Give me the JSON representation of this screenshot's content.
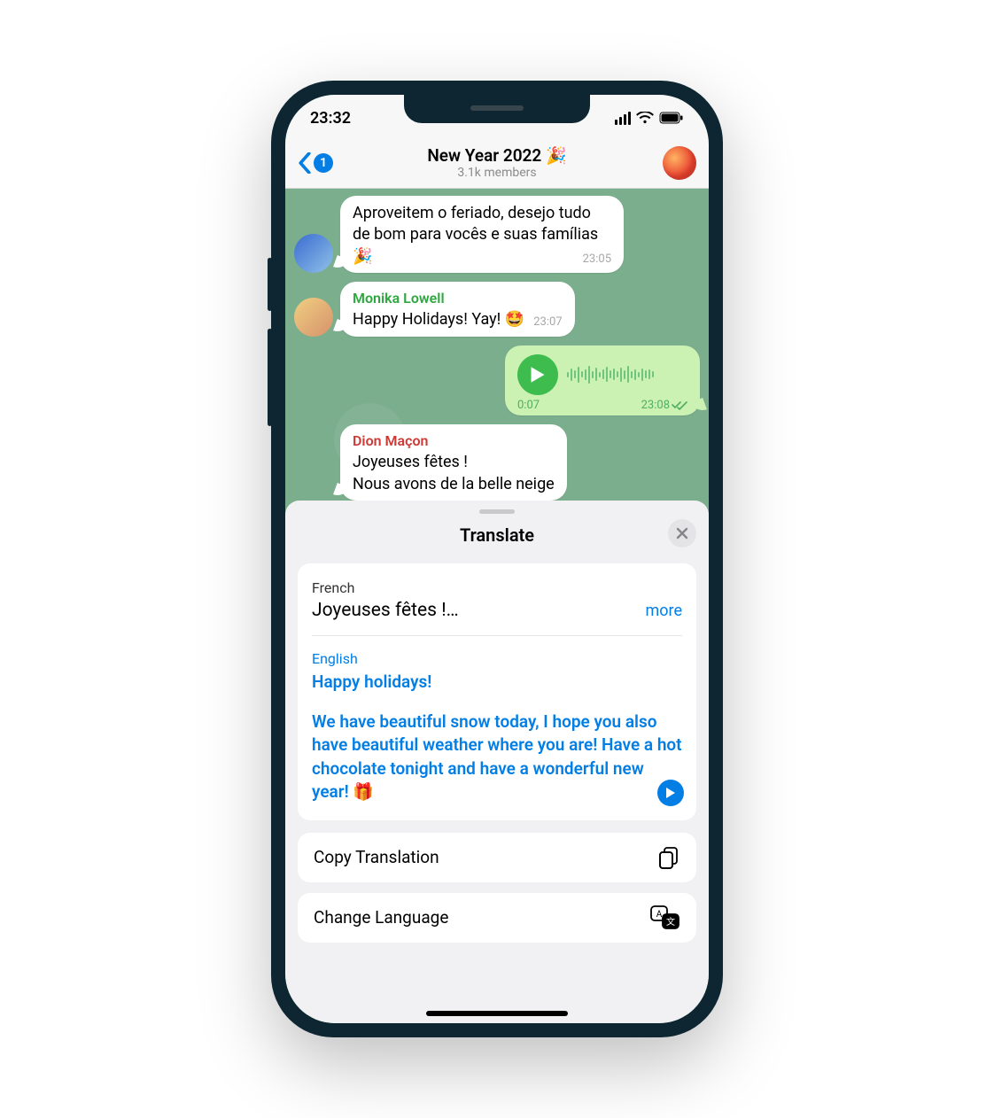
{
  "status_bar": {
    "time": "23:32"
  },
  "nav": {
    "badge": "1",
    "title": "New Year 2022 🎉",
    "subtitle": "3.1k members"
  },
  "messages": {
    "m1": {
      "text": "Aproveitem o feriado, desejo tudo de bom para vocês e suas famílias 🎉",
      "time": "23:05"
    },
    "m2": {
      "sender": "Monika Lowell",
      "text": "Happy Holidays! Yay! 🤩",
      "time": "23:07"
    },
    "voice": {
      "duration": "0:07",
      "time": "23:08"
    },
    "m3": {
      "sender": "Dion Maçon",
      "line1": "Joyeuses fêtes !",
      "line2": "Nous avons de la belle neige"
    }
  },
  "sheet": {
    "title": "Translate",
    "source_lang": "French",
    "source_text": "Joyeuses fêtes !…",
    "more": "more",
    "target_lang": "English",
    "target_heading": "Happy holidays!",
    "target_body": "We have beautiful snow today, I hope you also have beautiful weather where you are! Have a hot chocolate tonight and have a wonderful new year! 🎁",
    "copy": "Copy Translation",
    "change": "Change Language"
  }
}
